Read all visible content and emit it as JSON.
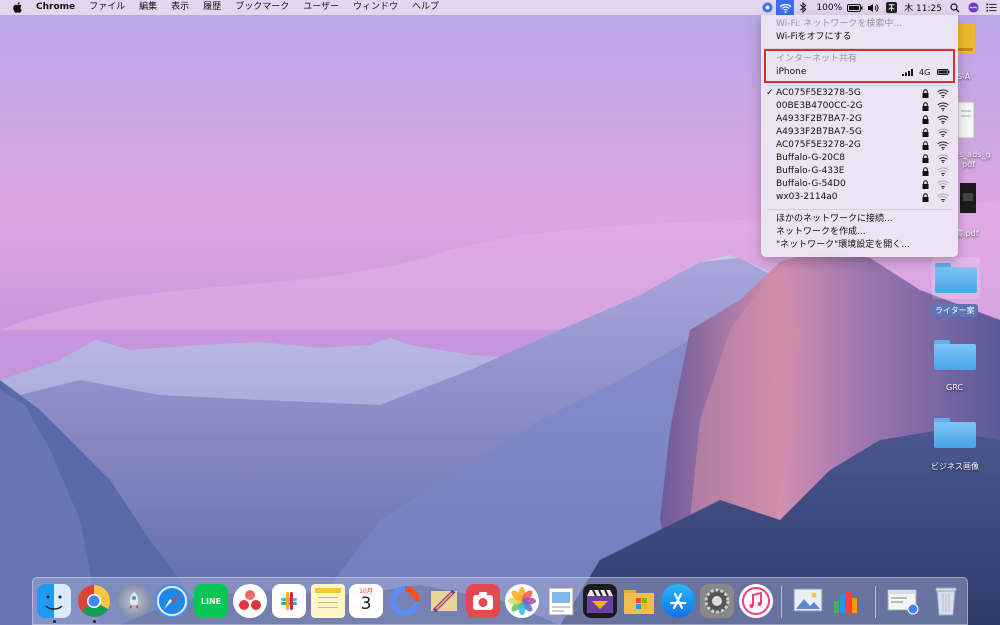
{
  "menubar": {
    "app_name": "Chrome",
    "menus": [
      "ファイル",
      "編集",
      "表示",
      "履歴",
      "ブックマーク",
      "ユーザー",
      "ウィンドウ",
      "ヘルプ"
    ],
    "battery_text": "100%",
    "clock_text": "木 11:25"
  },
  "wifi_menu": {
    "status": "Wi-Fi: ネットワークを検索中...",
    "turn_off": "Wi-Fiをオフにする",
    "hotspot_header": "インターネット共有",
    "hotspot_name": "iPhone",
    "hotspot_network": "4G",
    "networks": [
      {
        "name": "AC075F5E3278-5G",
        "checked": true
      },
      {
        "name": "00BE3B4700CC-2G",
        "checked": false
      },
      {
        "name": "A4933F2B7BA7-2G",
        "checked": false
      },
      {
        "name": "A4933F2B7BA7-5G",
        "checked": false
      },
      {
        "name": "AC075F5E3278-2G",
        "checked": false
      },
      {
        "name": "Buffalo-G-20C8",
        "checked": false
      },
      {
        "name": "Buffalo-G-433E",
        "checked": false
      },
      {
        "name": "Buffalo-G-54D0",
        "checked": false
      },
      {
        "name": "wx03-2114a0",
        "checked": false
      }
    ],
    "check_mark": "✓",
    "join_other": "ほかのネットワークに接続...",
    "create_network": "ネットワークを作成...",
    "open_prefs": "\"ネットワーク\"環境設定を開く..."
  },
  "desktop": {
    "icons": [
      {
        "label": "S-A"
      },
      {
        "label": "s_ads_g"
      },
      {
        "label": "pdf"
      },
      {
        "label": "書.pdf"
      },
      {
        "label": "ライター案"
      },
      {
        "label": "GRC"
      },
      {
        "label": "ビジネス画像"
      }
    ]
  },
  "dock": {
    "calendar_month": "10月",
    "calendar_day": "3",
    "line_label": "LINE"
  },
  "colors": {
    "accent": "#3d6df0",
    "highlight": "#e22c2c"
  }
}
